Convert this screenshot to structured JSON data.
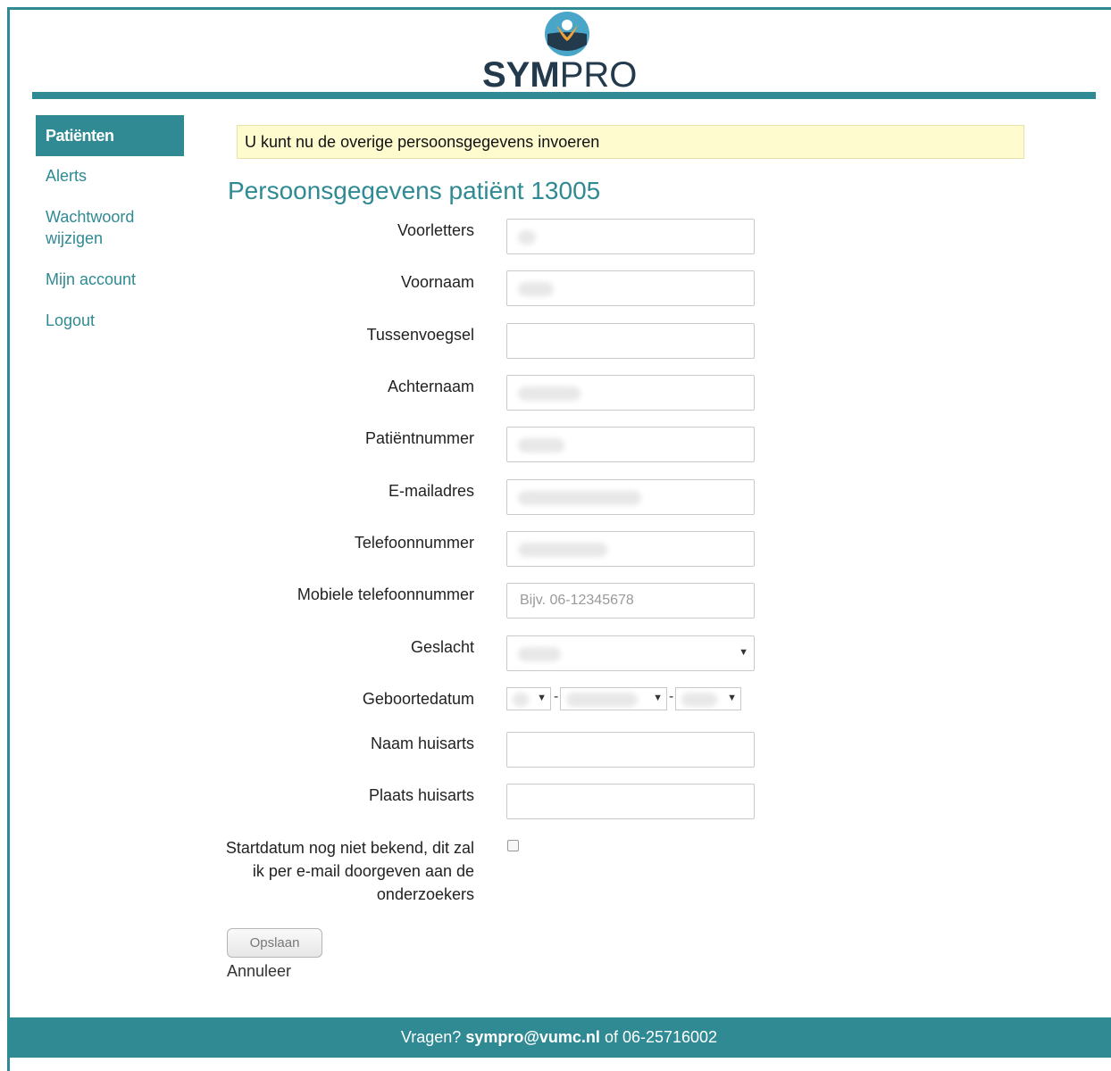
{
  "brand": {
    "logo_bold": "SYM",
    "logo_light": "PRO",
    "accent_color": "#2f8a93"
  },
  "sidebar": {
    "items": [
      {
        "label": "Patiënten"
      },
      {
        "label": "Alerts"
      },
      {
        "label": "Wachtwoord wijzigen"
      },
      {
        "label": "Mijn account"
      },
      {
        "label": "Logout"
      }
    ]
  },
  "alert": {
    "message": "U kunt nu de overige persoonsgegevens invoeren"
  },
  "form": {
    "title": "Persoonsgegevens patiënt 13005",
    "fields": {
      "voorletters": {
        "label": "Voorletters"
      },
      "voornaam": {
        "label": "Voornaam"
      },
      "tussenvoegsel": {
        "label": "Tussenvoegsel"
      },
      "achternaam": {
        "label": "Achternaam"
      },
      "patientnummer": {
        "label": "Patiëntnummer"
      },
      "email": {
        "label": "E-mailadres"
      },
      "telefoon": {
        "label": "Telefoonnummer"
      },
      "mobiel": {
        "label": "Mobiele telefoonnummer",
        "placeholder": "Bijv. 06-12345678"
      },
      "geslacht": {
        "label": "Geslacht"
      },
      "geboortedatum": {
        "label": "Geboortedatum",
        "separator": "-"
      },
      "naam_huisarts": {
        "label": "Naam huisarts"
      },
      "plaats_huisarts": {
        "label": "Plaats huisarts"
      },
      "startdatum": {
        "label": "Startdatum nog niet bekend, dit zal ik per e-mail doorgeven aan de onderzoekers"
      }
    },
    "save_label": "Opslaan",
    "cancel_label": "Annuleer"
  },
  "footer": {
    "prefix": "Vragen?",
    "email": "sympro@vumc.nl",
    "middle": "of",
    "phone": "06-25716002"
  }
}
